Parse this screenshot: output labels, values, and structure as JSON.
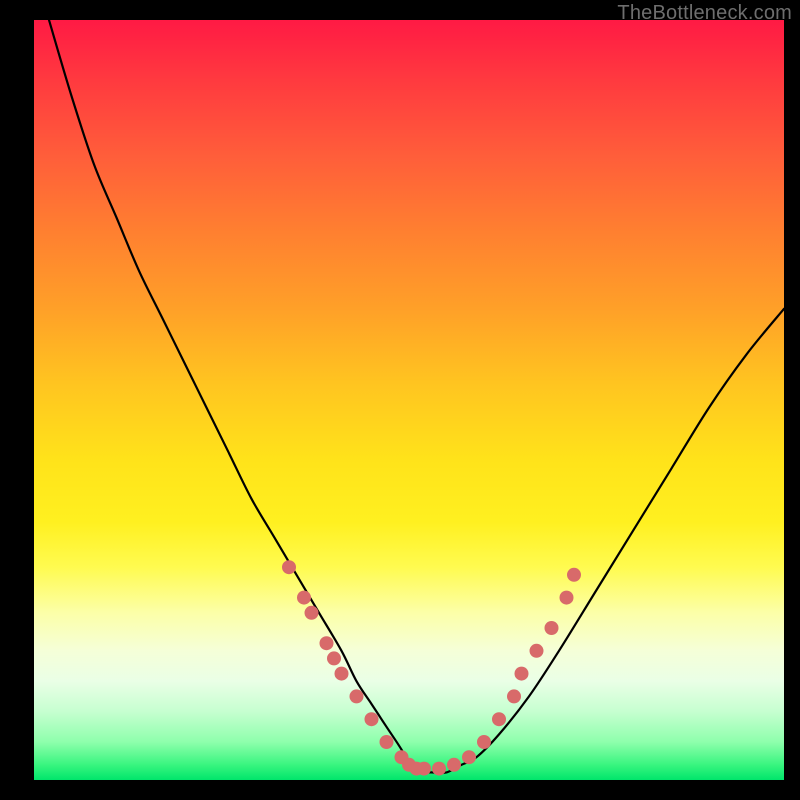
{
  "watermark": "TheBottleneck.com",
  "colors": {
    "background_frame": "#000000",
    "curve": "#000000",
    "marker": "#d86a6a",
    "gradient_stops": [
      "#ff1a44",
      "#ff3a3f",
      "#ff5e3a",
      "#ff8030",
      "#ffa028",
      "#ffc520",
      "#ffe31a",
      "#fff020",
      "#fffb50",
      "#fcffa8",
      "#f5ffd8",
      "#eaffe6",
      "#c6ffd0",
      "#8effac",
      "#39f57f",
      "#00e56b"
    ]
  },
  "chart_data": {
    "type": "line",
    "title": "",
    "xlabel": "",
    "ylabel": "",
    "xlim": [
      0,
      100
    ],
    "ylim": [
      0,
      100
    ],
    "grid": false,
    "legend": null,
    "series": [
      {
        "name": "bottleneck-curve",
        "x": [
          2,
          5,
          8,
          11,
          14,
          17,
          20,
          23,
          26,
          29,
          32,
          35,
          38,
          41,
          43,
          45,
          47,
          49,
          50,
          51,
          52,
          53,
          55,
          57,
          59,
          62,
          66,
          70,
          75,
          80,
          85,
          90,
          95,
          100
        ],
        "y": [
          100,
          90,
          81,
          74,
          67,
          61,
          55,
          49,
          43,
          37,
          32,
          27,
          22,
          17,
          13,
          10,
          7,
          4,
          2,
          1,
          1,
          1,
          1,
          2,
          3,
          6,
          11,
          17,
          25,
          33,
          41,
          49,
          56,
          62
        ]
      }
    ],
    "markers": [
      {
        "x": 34,
        "y": 28
      },
      {
        "x": 36,
        "y": 24
      },
      {
        "x": 37,
        "y": 22
      },
      {
        "x": 39,
        "y": 18
      },
      {
        "x": 40,
        "y": 16
      },
      {
        "x": 41,
        "y": 14
      },
      {
        "x": 43,
        "y": 11
      },
      {
        "x": 45,
        "y": 8
      },
      {
        "x": 47,
        "y": 5
      },
      {
        "x": 49,
        "y": 3
      },
      {
        "x": 50,
        "y": 2
      },
      {
        "x": 51,
        "y": 1.5
      },
      {
        "x": 52,
        "y": 1.5
      },
      {
        "x": 54,
        "y": 1.5
      },
      {
        "x": 56,
        "y": 2
      },
      {
        "x": 58,
        "y": 3
      },
      {
        "x": 60,
        "y": 5
      },
      {
        "x": 62,
        "y": 8
      },
      {
        "x": 64,
        "y": 11
      },
      {
        "x": 65,
        "y": 14
      },
      {
        "x": 67,
        "y": 17
      },
      {
        "x": 69,
        "y": 20
      },
      {
        "x": 71,
        "y": 24
      },
      {
        "x": 72,
        "y": 27
      }
    ],
    "marker_radius_px": 7
  }
}
